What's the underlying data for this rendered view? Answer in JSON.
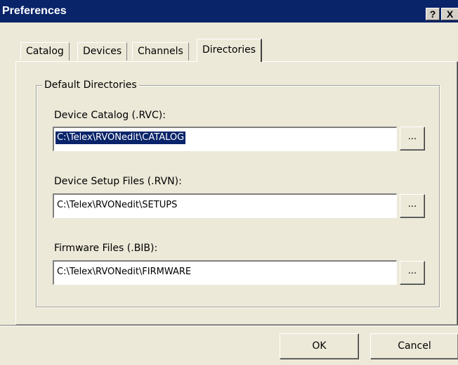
{
  "window": {
    "title": "Preferences",
    "help_label": "?",
    "close_label": "X"
  },
  "tabs": [
    {
      "label": "Catalog",
      "active": false
    },
    {
      "label": "Devices",
      "active": false
    },
    {
      "label": "Channels",
      "active": false
    },
    {
      "label": "Directories",
      "active": true
    }
  ],
  "group": {
    "title": "Default Directories",
    "fields": [
      {
        "label": "Device Catalog (.RVC):",
        "value": "C:\\Telex\\RVONedit\\CATALOG",
        "selected": true
      },
      {
        "label": "Device Setup Files (.RVN):",
        "value": "C:\\Telex\\RVONedit\\SETUPS",
        "selected": false
      },
      {
        "label": "Firmware Files (.BIB):",
        "value": "C:\\Telex\\RVONedit\\FIRMWARE",
        "selected": false
      }
    ],
    "browse_label": "..."
  },
  "footer": {
    "ok_label": "OK",
    "cancel_label": "Cancel"
  },
  "colors": {
    "titlebar": "#0a246a",
    "face": "#ece9d8",
    "selection": "#0a246a"
  }
}
